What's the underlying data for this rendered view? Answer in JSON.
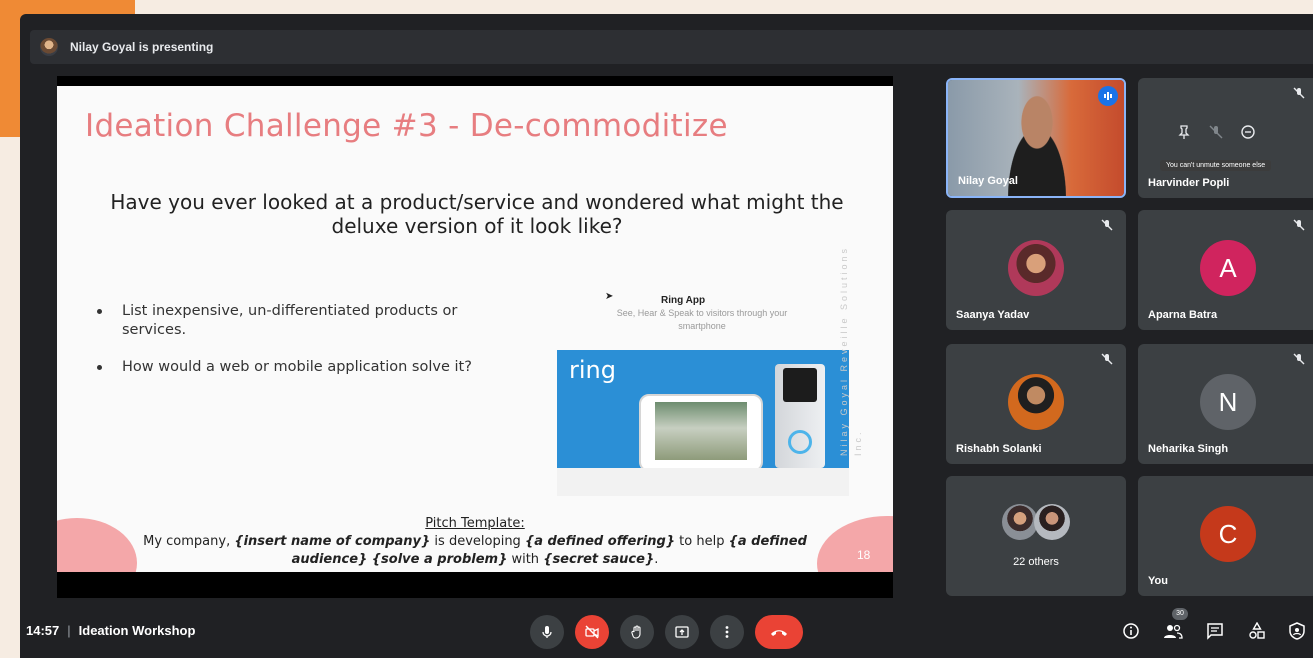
{
  "presenter_bar": {
    "text": "Nilay Goyal is presenting"
  },
  "slide": {
    "title": "Ideation Challenge #3 - De-commoditize",
    "question": "Have you ever looked at a product/service and wondered what might the deluxe version of it look like?",
    "bullets": [
      "List inexpensive, un-differentiated products or services.",
      "How would a web or mobile application solve it?"
    ],
    "ring_app_title": "Ring App",
    "ring_app_subtitle": "See, Hear & Speak to visitors through your smartphone",
    "ring_logo": "ring",
    "watermark": "Nilay Goyal Reveille Solutions Inc.",
    "pitch_heading": "Pitch Template:",
    "pitch_line1_a": "My company, ",
    "pitch_line1_b": "{insert name of company}",
    "pitch_line1_c": " is developing ",
    "pitch_line1_d": "{a defined offering}",
    "pitch_line1_e": " to help ",
    "pitch_line1_f": "{a defined",
    "pitch_line2_a": "audience} {solve a problem}",
    "pitch_line2_b": " with ",
    "pitch_line2_c": "{secret sauce}",
    "pitch_line2_d": ".",
    "page_number": "18"
  },
  "participants": {
    "nilay": {
      "name": "Nilay Goyal"
    },
    "harvinder": {
      "name": "Harvinder Popli",
      "tooltip": "You can't unmute someone else"
    },
    "saanya": {
      "name": "Saanya Yadav"
    },
    "aparna": {
      "name": "Aparna Batra",
      "initial": "A",
      "color": "#d0245e"
    },
    "rishabh": {
      "name": "Rishabh Solanki"
    },
    "neharika": {
      "name": "Neharika Singh",
      "initial": "N",
      "color": "#5f6368"
    },
    "others": {
      "label": "22 others"
    },
    "you": {
      "name": "You",
      "initial": "C",
      "color": "#c5391b"
    }
  },
  "bottom_bar": {
    "time": "14:57",
    "separator": "|",
    "meeting_title": "Ideation Workshop",
    "people_count": "30"
  },
  "colors": {
    "leave_red": "#ea4335",
    "accent_blue": "#1a73e8",
    "slide_title": "#e77d80"
  }
}
